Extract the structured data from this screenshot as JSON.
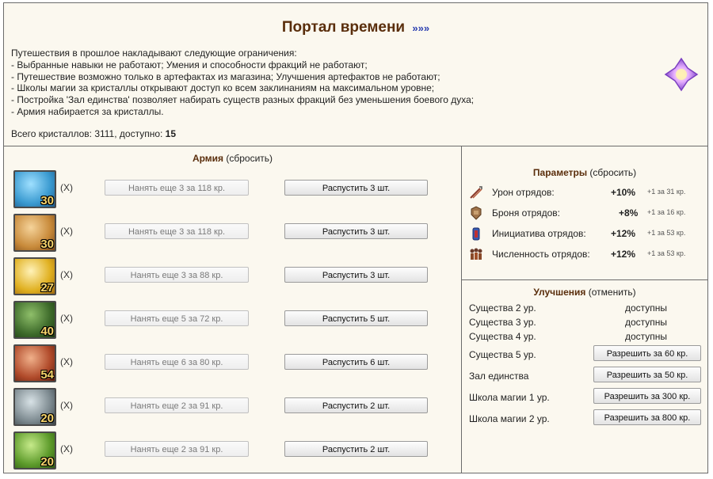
{
  "portal": {
    "title": "Портал времени",
    "more": "»»»",
    "intro": "Путешествия в прошлое накладывают следующие ограничения:",
    "restrictions": [
      "- Выбранные навыки не работают; Умения и способности фракций не работают;",
      "- Путешествие возможно только в артефактах из магазина; Улучшения артефактов не работают;",
      "- Школы магии за кристаллы открывают доступ ко всем заклинаниям на максимальном уровне;",
      "- Постройка 'Зал единства' позволяет набирать существ разных фракций без уменьшения боевого духа;",
      "- Армия набирается за кристаллы."
    ],
    "crystals_label": "Всего кристаллов: 3111, доступно: ",
    "crystals_available": "15",
    "crystal_icon": "crystal-icon"
  },
  "army": {
    "title": "Армия",
    "reset": " (сбросить)",
    "units": [
      {
        "count": "30",
        "x": "(X)",
        "hire": "Нанять еще 3 за 118 кр.",
        "dismiss": "Распустить 3 шт.",
        "color": "#3a9ad0"
      },
      {
        "count": "30",
        "x": "(X)",
        "hire": "Нанять еще 3 за 118 кр.",
        "dismiss": "Распустить 3 шт.",
        "color": "#c88a3a"
      },
      {
        "count": "27",
        "x": "(X)",
        "hire": "Нанять еще 3 за 88 кр.",
        "dismiss": "Распустить 3 шт.",
        "color": "#e0b020"
      },
      {
        "count": "40",
        "x": "(X)",
        "hire": "Нанять еще 5 за 72 кр.",
        "dismiss": "Распустить 5 шт.",
        "color": "#3d6a2a"
      },
      {
        "count": "54",
        "x": "(X)",
        "hire": "Нанять еще 6 за 80 кр.",
        "dismiss": "Распустить 6 шт.",
        "color": "#b04a2a"
      },
      {
        "count": "20",
        "x": "(X)",
        "hire": "Нанять еще 2 за 91 кр.",
        "dismiss": "Распустить 2 шт.",
        "color": "#7d8a90"
      },
      {
        "count": "20",
        "x": "(X)",
        "hire": "Нанять еще 2 за 91 кр.",
        "dismiss": "Распустить 2 шт.",
        "color": "#5c9a2a"
      }
    ]
  },
  "params": {
    "title": "Параметры",
    "reset": " (сбросить)",
    "rows": [
      {
        "icon": "damage-icon",
        "label": "Урон отрядов:",
        "value": "+10%",
        "next": "+1 за 31 кр."
      },
      {
        "icon": "armor-icon",
        "label": "Броня отрядов:",
        "value": "+8%",
        "next": "+1 за 16 кр."
      },
      {
        "icon": "initiative-icon",
        "label": "Инициатива отрядов:",
        "value": "+12%",
        "next": "+1 за 53 кр."
      },
      {
        "icon": "troop-size-icon",
        "label": "Численность отрядов:",
        "value": "+12%",
        "next": "+1 за 53 кр."
      }
    ]
  },
  "upgrades": {
    "title": "Улучшения",
    "cancel": " (отменить)",
    "available": [
      {
        "label": "Существа 2 ур.",
        "status": "доступны"
      },
      {
        "label": "Существа 3 ур.",
        "status": "доступны"
      },
      {
        "label": "Существа 4 ур.",
        "status": "доступны"
      }
    ],
    "buyable": [
      {
        "label": "Существа 5 ур.",
        "button": "Разрешить за 60 кр."
      },
      {
        "label": "Зал единства",
        "button": "Разрешить за 50 кр."
      },
      {
        "label": "Школа магии 1 ур.",
        "button": "Разрешить за 300 кр."
      },
      {
        "label": "Школа магии 2 ур.",
        "button": "Разрешить за 800 кр."
      }
    ]
  }
}
